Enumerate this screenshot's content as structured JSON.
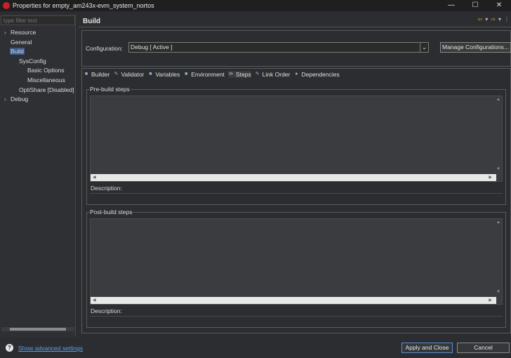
{
  "window": {
    "title": "Properties for empty_am243x-evm_system_nortos",
    "controls": {
      "minimize": "—",
      "maximize": "☐",
      "close": "✕"
    }
  },
  "sidebar": {
    "filter_placeholder": "type filter text",
    "items": [
      {
        "label": "Resource",
        "arrow": "›",
        "expandable": true
      },
      {
        "label": "General",
        "expandable": false
      },
      {
        "label": "Build",
        "selected": true,
        "expandable": false
      },
      {
        "label": "SysConfig",
        "expandable": false
      },
      {
        "label": "Basic Options",
        "expandable": false
      },
      {
        "label": "Miscellaneous",
        "expandable": false
      },
      {
        "label": "OptiShare  [Disabled]",
        "expandable": false
      },
      {
        "label": "Debug",
        "arrow": "›",
        "expandable": true
      }
    ]
  },
  "page": {
    "title": "Build",
    "nav_icons": {
      "back": "⇦",
      "back_menu": "▾",
      "forward": "⇨",
      "forward_menu": "▾",
      "menu": "⋮"
    }
  },
  "configuration": {
    "label": "Configuration:",
    "value": "Debug  [ Active ]",
    "dropdown_arrow": "⌄",
    "manage_button": "Manage Configurations..."
  },
  "tabs": [
    {
      "label": "Builder",
      "icon": "builder-icon",
      "glyph": "■"
    },
    {
      "label": "Validator",
      "icon": "validator-icon",
      "glyph": "✎"
    },
    {
      "label": "Variables",
      "icon": "variables-icon",
      "glyph": "■"
    },
    {
      "label": "Environment",
      "icon": "environment-icon",
      "glyph": "■"
    },
    {
      "label": "Steps",
      "icon": "steps-icon",
      "glyph": "≫",
      "active": true
    },
    {
      "label": "Link Order",
      "icon": "link-order-icon",
      "glyph": "✎"
    },
    {
      "label": "Dependencies",
      "icon": "dependencies-icon",
      "glyph": "●"
    }
  ],
  "steps": {
    "pre_build": {
      "label": "Pre-build steps",
      "description_label": "Description:"
    },
    "post_build": {
      "label": "Post-build steps",
      "description_label": "Description:"
    },
    "scroll_glyphs": {
      "up": "▲",
      "down": "▼",
      "left": "◀",
      "right": "▶"
    }
  },
  "footer": {
    "help_glyph": "?",
    "advanced_link": "Show advanced settings",
    "apply_button": "Apply and Close",
    "cancel_button": "Cancel"
  },
  "colors": {
    "background": "#2b2d30",
    "title_bar": "#1f1f1f",
    "selection": "#3d5a8a",
    "link": "#5aa0e6",
    "app_icon": "#c8202a"
  }
}
